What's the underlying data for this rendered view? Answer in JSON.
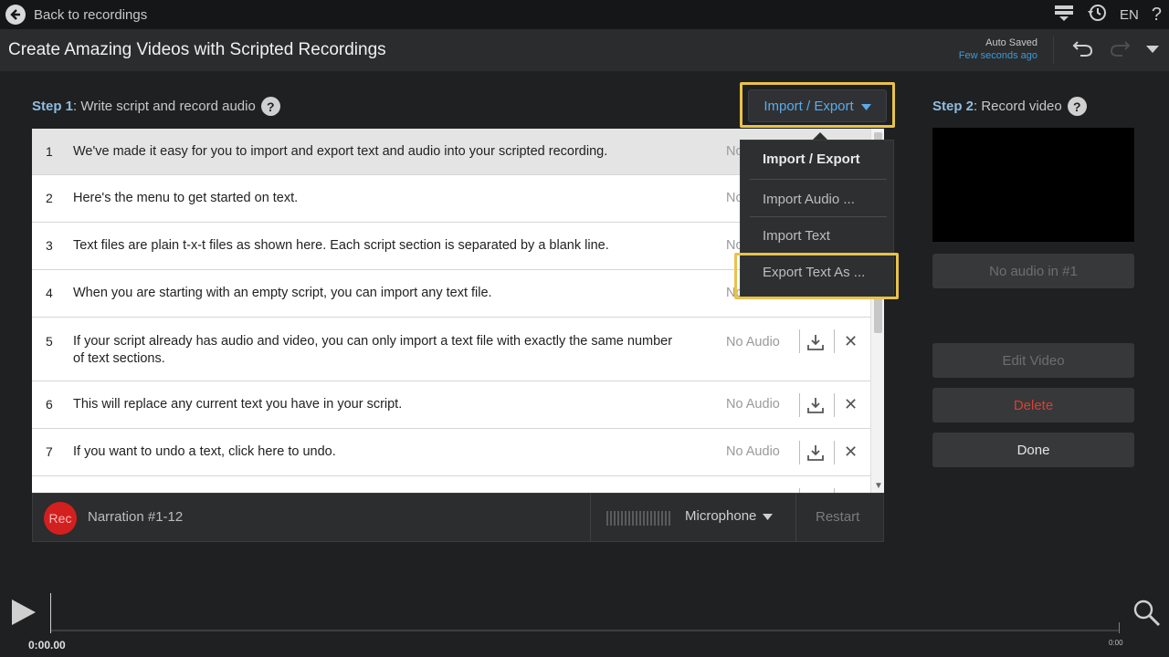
{
  "topbar": {
    "back_label": "Back to recordings",
    "lang": "EN",
    "help": "?"
  },
  "titlebar": {
    "title": "Create Amazing Videos with Scripted Recordings",
    "auto_saved": "Auto Saved",
    "saved_time": "Few seconds ago"
  },
  "step1": {
    "prefix": "Step 1",
    "label": ": Write script and record audio"
  },
  "step2": {
    "prefix": "Step 2",
    "label": ": Record video"
  },
  "import_export": {
    "button_label": "Import / Export",
    "menu_title": "Import / Export",
    "items": [
      "Import Audio ...",
      "Import Text",
      "Export Text As ..."
    ]
  },
  "script": {
    "no_audio_label": "No Audio",
    "rows": [
      {
        "num": "1",
        "text": "We've made it easy for you to import and export text and audio into your scripted recording."
      },
      {
        "num": "2",
        "text": "Here's the menu to get started on text."
      },
      {
        "num": "3",
        "text": "Text files are plain t-x-t files as shown here. Each script section is separated by a blank line."
      },
      {
        "num": "4",
        "text": "When you are starting with an empty script, you can import any text file."
      },
      {
        "num": "5",
        "text": "If your script already has audio and video, you can only import a text file with exactly the same number of text sections."
      },
      {
        "num": "6",
        "text": "This will replace any current text you have in your script."
      },
      {
        "num": "7",
        "text": "If you want to undo a text, click here to undo."
      }
    ]
  },
  "recbar": {
    "rec_label": "Rec",
    "narration": "Narration #1-12",
    "microphone": "Microphone",
    "restart": "Restart"
  },
  "right": {
    "no_audio": "No audio in #1",
    "edit_video": "Edit Video",
    "delete": "Delete",
    "done": "Done"
  },
  "timeline": {
    "current": "0:00.00",
    "end": "0:00"
  },
  "colors": {
    "accent_blue": "#3b9ad8",
    "highlight": "#e8c24c",
    "rec_red": "#d41f1f",
    "delete_red": "#d8402f"
  }
}
